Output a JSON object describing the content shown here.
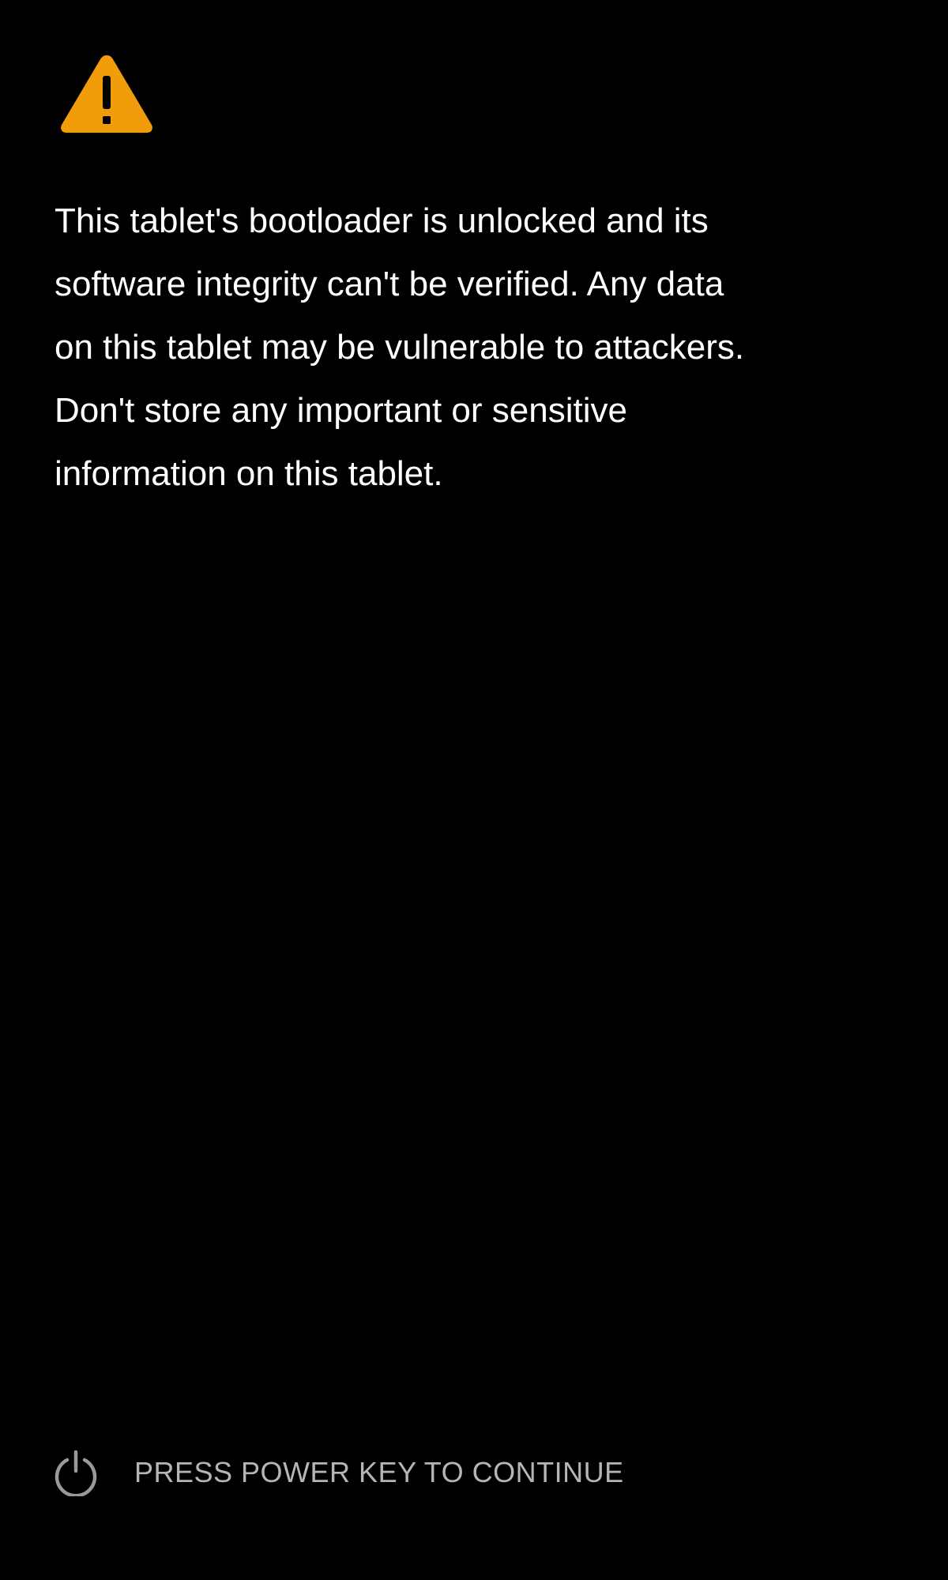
{
  "screen": {
    "background_color": "#000000",
    "accent_color": "#F09C0B"
  },
  "warning": {
    "icon": "warning-triangle-icon",
    "message_lines": [
      "This tablet's bootloader is unlocked and its",
      "software integrity can't be verified. Any data",
      "on this tablet may be vulnerable to attackers.",
      "Don't store any important or sensitive",
      "information on this tablet."
    ]
  },
  "footer": {
    "icon": "power-icon",
    "label": "PRESS POWER KEY TO CONTINUE",
    "label_color": "#B5B5B5"
  }
}
